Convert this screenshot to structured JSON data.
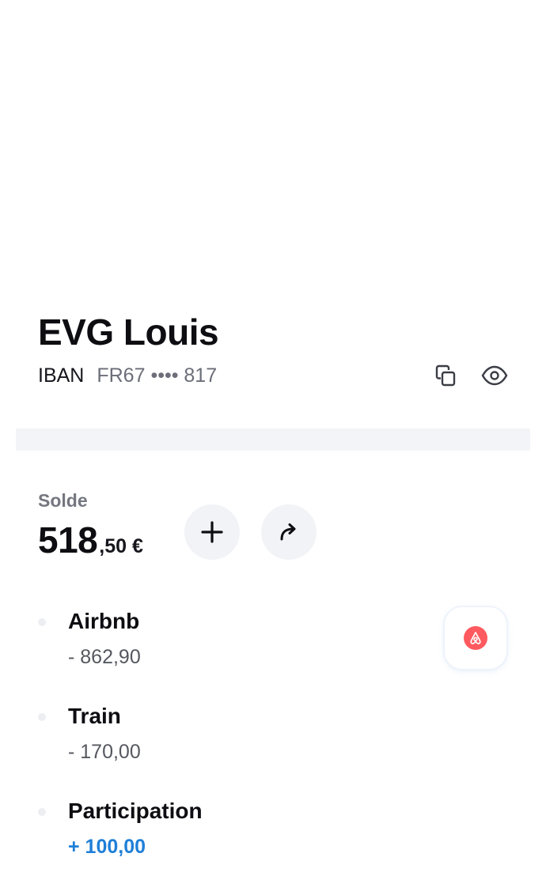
{
  "account": {
    "name": "EVG Louis",
    "iban_label": "IBAN",
    "iban_masked": "FR67 •••• 817"
  },
  "balance": {
    "label": "Solde",
    "integer": "518",
    "decimal": ",50 €"
  },
  "actions": {
    "add_icon": "plus-icon",
    "transfer_icon": "forward-arrow-icon",
    "copy_icon": "copy-icon",
    "visibility_icon": "eye-icon"
  },
  "transactions": [
    {
      "name": "Airbnb",
      "amount": "- 862,90",
      "type": "debit"
    },
    {
      "name": "Train",
      "amount": "- 170,00",
      "type": "debit"
    },
    {
      "name": "Participation",
      "amount": "+ 100,00",
      "type": "credit"
    }
  ],
  "merchant_badge": {
    "icon": "airbnb-logo-icon",
    "color": "#ff5a5f"
  },
  "colors": {
    "credit": "#1f7fd8",
    "divider": "#f3f4f7",
    "button_bg": "#f2f3f6"
  }
}
